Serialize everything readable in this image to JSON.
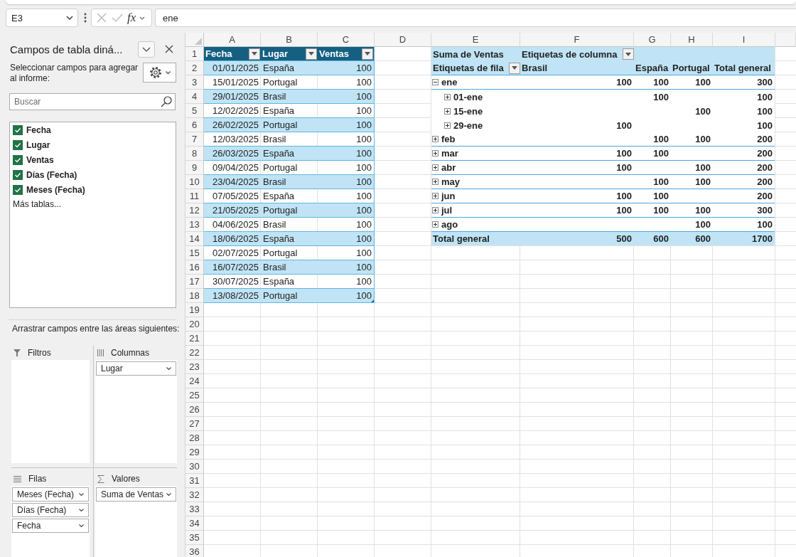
{
  "formula_bar": {
    "name_box": "E3",
    "edit_disabled": true,
    "function_label": "fx",
    "formula": "ene"
  },
  "pivot_panel": {
    "title": "Campos de tabla diná...",
    "prompt": "Seleccionar campos para agregar al informe:",
    "search": {
      "placeholder": "Buscar"
    },
    "fields": [
      {
        "label": "Fecha",
        "checked": true
      },
      {
        "label": "Lugar",
        "checked": true
      },
      {
        "label": "Ventas",
        "checked": true
      },
      {
        "label": "Días (Fecha)",
        "checked": true
      },
      {
        "label": "Meses (Fecha)",
        "checked": true
      }
    ],
    "more_tables": "Más tablas...",
    "drag_hint": "Arrastrar campos entre las áreas siguientes:",
    "areas": [
      {
        "kind": "filters",
        "title": "Filtros"
      },
      {
        "kind": "columns",
        "title": "Columnas",
        "items": [
          "Lugar"
        ]
      },
      {
        "kind": "rows",
        "title": "Filas",
        "items": [
          "Meses (Fecha)",
          "Días (Fecha)",
          "Fecha"
        ]
      },
      {
        "kind": "values",
        "title": "Valores",
        "items": [
          "Suma de Ventas"
        ]
      }
    ]
  },
  "sheet": {
    "column_headers": [
      "A",
      "B",
      "C",
      "D",
      "E",
      "F",
      "G",
      "H",
      "I"
    ],
    "row_numbers": [
      "1",
      "2",
      "3",
      "4",
      "5",
      "6",
      "7",
      "8",
      "9",
      "10",
      "11",
      "12",
      "13",
      "14",
      "15",
      "16",
      "17",
      "18",
      "19",
      "20",
      "21",
      "22",
      "23",
      "24",
      "25",
      "26",
      "27",
      "28",
      "29",
      "30",
      "31",
      "32",
      "33",
      "34",
      "35",
      "36"
    ],
    "table": {
      "columns": [
        {
          "label": "Fecha",
          "kind": "date"
        },
        {
          "label": "Lugar",
          "kind": "text"
        },
        {
          "label": "Ventas",
          "kind": "number"
        }
      ],
      "rows": [
        [
          "01/01/2025",
          "España",
          "100"
        ],
        [
          "15/01/2025",
          "Portugal",
          "100"
        ],
        [
          "29/01/2025",
          "Brasil",
          "100"
        ],
        [
          "12/02/2025",
          "España",
          "100"
        ],
        [
          "26/02/2025",
          "Portugal",
          "100"
        ],
        [
          "12/03/2025",
          "Brasil",
          "100"
        ],
        [
          "26/03/2025",
          "España",
          "100"
        ],
        [
          "09/04/2025",
          "Portugal",
          "100"
        ],
        [
          "23/04/2025",
          "Brasil",
          "100"
        ],
        [
          "07/05/2025",
          "España",
          "100"
        ],
        [
          "21/05/2025",
          "Portugal",
          "100"
        ],
        [
          "04/06/2025",
          "Brasil",
          "100"
        ],
        [
          "18/06/2025",
          "España",
          "100"
        ],
        [
          "02/07/2025",
          "Portugal",
          "100"
        ],
        [
          "16/07/2025",
          "Brasil",
          "100"
        ],
        [
          "30/07/2025",
          "España",
          "100"
        ],
        [
          "13/08/2025",
          "Portugal",
          "100"
        ]
      ]
    },
    "pivot": {
      "value_label": "Suma de Ventas",
      "column_labels": "Etiquetas de columna",
      "row_labels": "Etiquetas de fila",
      "columns": [
        "Brasil",
        "España",
        "Portugal",
        "Total general"
      ],
      "rows": [
        {
          "label": "ene",
          "expanded": true,
          "brasil": "100",
          "espana": "100",
          "portugal": "100",
          "total": "300",
          "children": [
            {
              "label": "01-ene",
              "expanded": false,
              "espana": "100",
              "total": "100"
            },
            {
              "label": "15-ene",
              "expanded": false,
              "portugal": "100",
              "total": "100"
            },
            {
              "label": "29-ene",
              "expanded": false,
              "brasil": "100",
              "total": "100"
            }
          ]
        },
        {
          "label": "feb",
          "expanded": false,
          "espana": "100",
          "portugal": "100",
          "total": "200"
        },
        {
          "label": "mar",
          "expanded": false,
          "brasil": "100",
          "espana": "100",
          "total": "200"
        },
        {
          "label": "abr",
          "expanded": false,
          "brasil": "100",
          "portugal": "100",
          "total": "200"
        },
        {
          "label": "may",
          "expanded": false,
          "espana": "100",
          "portugal": "100",
          "total": "200"
        },
        {
          "label": "jun",
          "expanded": false,
          "brasil": "100",
          "espana": "100",
          "total": "200"
        },
        {
          "label": "jul",
          "expanded": false,
          "brasil": "100",
          "espana": "100",
          "portugal": "100",
          "total": "300"
        },
        {
          "label": "ago",
          "expanded": false,
          "portugal": "100",
          "total": "100"
        }
      ],
      "total": {
        "label": "Total general",
        "brasil": "500",
        "espana": "600",
        "portugal": "600",
        "total": "1700"
      }
    }
  }
}
